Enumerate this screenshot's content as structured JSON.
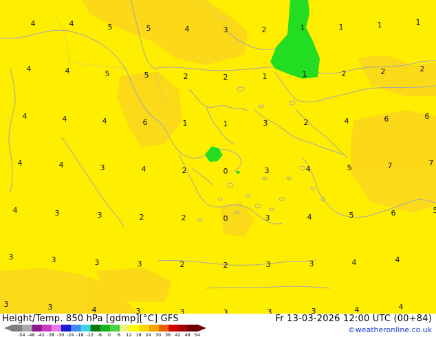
{
  "header": {
    "title": "Height/Temp. 850 hPa [gdmp][°C] GFS",
    "run": "Fr 13-03-2026 12:00 UTC (00+84)",
    "credit": "©weatheronline.co.uk"
  },
  "legend": {
    "ticks": [
      "-54",
      "-48",
      "-42",
      "-38",
      "-30",
      "-24",
      "-18",
      "-12",
      "-6",
      "0",
      "6",
      "12",
      "18",
      "24",
      "30",
      "36",
      "42",
      "48",
      "54"
    ],
    "colors": [
      "#7f7f7f",
      "#a9a9a9",
      "#8c1a8c",
      "#c33cc3",
      "#e87ae8",
      "#1c1cd6",
      "#3c8cf0",
      "#40d0e8",
      "#0a7a0a",
      "#19b219",
      "#4ad24a",
      "#f0f07a",
      "#ffff00",
      "#ffd700",
      "#f5a300",
      "#e36000",
      "#d00000",
      "#a00000",
      "#6b0000"
    ]
  },
  "colors": {
    "base": "#ffee00",
    "warm": "#fbd71c",
    "green": "#22dd22",
    "coast": "#a7a7a7"
  },
  "labels": [
    {
      "t": "4"
    },
    {
      "t": "4"
    },
    {
      "t": "5"
    },
    {
      "t": "5"
    },
    {
      "t": "4"
    },
    {
      "t": "3"
    },
    {
      "t": "2"
    },
    {
      "t": "1"
    },
    {
      "t": "1"
    },
    {
      "t": "1"
    },
    {
      "t": "1"
    },
    {
      "t": "4"
    },
    {
      "t": "4"
    },
    {
      "t": "5"
    },
    {
      "t": "5"
    },
    {
      "t": "2"
    },
    {
      "t": "2"
    },
    {
      "t": "1"
    },
    {
      "t": "1"
    },
    {
      "t": "2"
    },
    {
      "t": "2"
    },
    {
      "t": "2"
    },
    {
      "t": "4"
    },
    {
      "t": "4"
    },
    {
      "t": "4"
    },
    {
      "t": "6"
    },
    {
      "t": "1"
    },
    {
      "t": "1"
    },
    {
      "t": "3"
    },
    {
      "t": "2"
    },
    {
      "t": "4"
    },
    {
      "t": "6"
    },
    {
      "t": "6"
    },
    {
      "t": "4"
    },
    {
      "t": "4"
    },
    {
      "t": "3"
    },
    {
      "t": "4"
    },
    {
      "t": "2"
    },
    {
      "t": "0"
    },
    {
      "t": "3"
    },
    {
      "t": "4"
    },
    {
      "t": "5"
    },
    {
      "t": "7"
    },
    {
      "t": "7"
    },
    {
      "t": "4"
    },
    {
      "t": "3"
    },
    {
      "t": "3"
    },
    {
      "t": "2"
    },
    {
      "t": "2"
    },
    {
      "t": "0"
    },
    {
      "t": "3"
    },
    {
      "t": "4"
    },
    {
      "t": "5"
    },
    {
      "t": "6"
    },
    {
      "t": "5"
    },
    {
      "t": "3"
    },
    {
      "t": "3"
    },
    {
      "t": "3"
    },
    {
      "t": "3"
    },
    {
      "t": "2"
    },
    {
      "t": "2"
    },
    {
      "t": "3"
    },
    {
      "t": "3"
    },
    {
      "t": "4"
    },
    {
      "t": "4"
    },
    {
      "t": "3"
    },
    {
      "t": "3"
    },
    {
      "t": "4"
    },
    {
      "t": "3"
    },
    {
      "t": "3"
    },
    {
      "t": "3"
    },
    {
      "t": "3"
    },
    {
      "t": "3"
    },
    {
      "t": "4"
    },
    {
      "t": "4"
    }
  ]
}
